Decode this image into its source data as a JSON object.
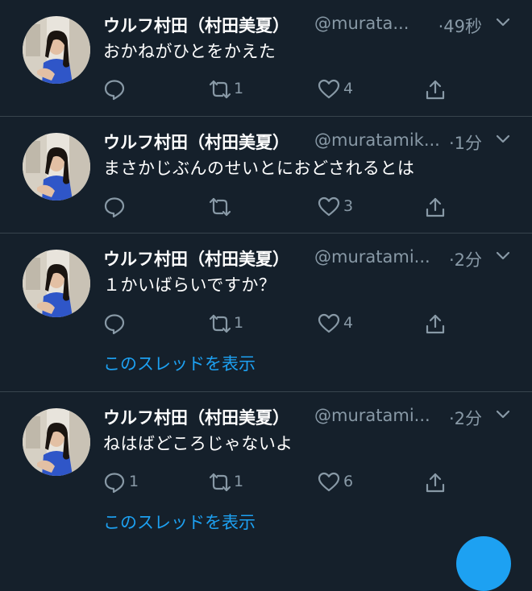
{
  "colors": {
    "background": "#15202b",
    "accent": "#1da1f2",
    "muted": "#8899a6",
    "divider": "#38444d"
  },
  "tweets": [
    {
      "name": "ウルフ村田（村田美夏）",
      "handle": "@murata...",
      "time": "·49秒",
      "text": "おかねがひとをかえた",
      "reply_count": "",
      "retweet_count": "1",
      "like_count": "4",
      "thread_link": ""
    },
    {
      "name": "ウルフ村田（村田美夏）",
      "handle": "@muratamik...",
      "time": "·1分",
      "text": "まさかじぶんのせいとにおどされるとは",
      "reply_count": "",
      "retweet_count": "",
      "like_count": "3",
      "thread_link": ""
    },
    {
      "name": "ウルフ村田（村田美夏）",
      "handle": "@muratami...",
      "time": "·2分",
      "text": "１かいばらいですか？",
      "reply_count": "",
      "retweet_count": "1",
      "like_count": "4",
      "thread_link": "このスレッドを表示"
    },
    {
      "name": "ウルフ村田（村田美夏）",
      "handle": "@muratami...",
      "time": "·2分",
      "text": "ねはばどころじゃないよ",
      "reply_count": "1",
      "retweet_count": "1",
      "like_count": "6",
      "thread_link": "このスレッドを表示"
    }
  ]
}
